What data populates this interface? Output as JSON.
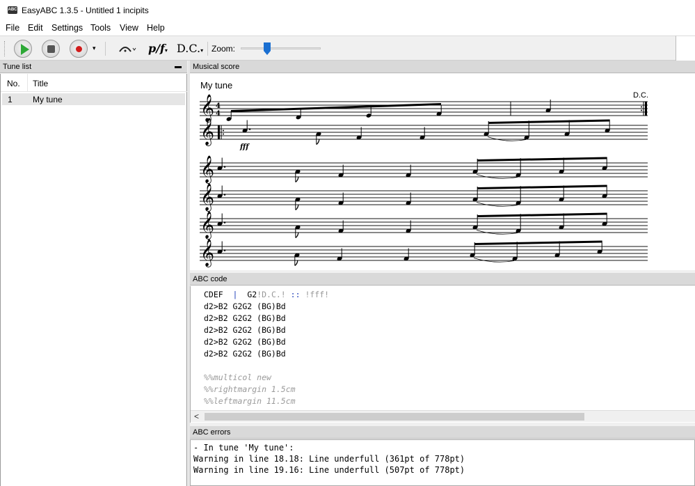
{
  "window": {
    "title": "EasyABC 1.3.5 - Untitled 1 incipits",
    "icon_label": "ABC"
  },
  "menu": [
    "File",
    "Edit",
    "Settings",
    "Tools",
    "View",
    "Help"
  ],
  "toolbar": {
    "play_icon": "play-icon",
    "stop_icon": "stop-icon",
    "record_icon": "record-icon",
    "dropdown_glyph": "▾",
    "dynamics_label": "p/f",
    "dc_label": "D.C.",
    "zoom_label": "Zoom:",
    "zoom_level": 0.33
  },
  "panels": {
    "tune_list": "Tune list",
    "score": "Musical score",
    "abc_code": "ABC code",
    "errors": "ABC errors",
    "minimize_glyph": "▬"
  },
  "tune_list": {
    "columns": [
      "No.",
      "Title"
    ],
    "rows": [
      {
        "no": "1",
        "title": "My tune"
      }
    ]
  },
  "score": {
    "title": "My tune",
    "dc_mark": "D.C.",
    "time_sig_top": "4",
    "time_sig_bottom": "4",
    "dynamic": "fff"
  },
  "abc_code": {
    "line1": {
      "a": "CDEF  ",
      "bar": "|",
      "b": "  G2",
      "c": "!D.C.!",
      "d": " :: ",
      "e": "!fff!"
    },
    "lines": [
      "d2>B2 G2G2 (BG)Bd",
      "d2>B2 G2G2 (BG)Bd",
      "d2>B2 G2G2 (BG)Bd",
      "d2>B2 G2G2 (BG)Bd",
      "d2>B2 G2G2 (BG)Bd"
    ],
    "comments": [
      "%%multicol new",
      "%%rightmargin 1.5cm",
      "%%leftmargin 11.5cm"
    ],
    "scroll_left": "<"
  },
  "errors": [
    "- In tune 'My tune':",
    "Warning in line 18.18: Line underfull (361pt of 778pt)",
    "Warning in line 19.16: Line underfull (507pt of 778pt)"
  ]
}
